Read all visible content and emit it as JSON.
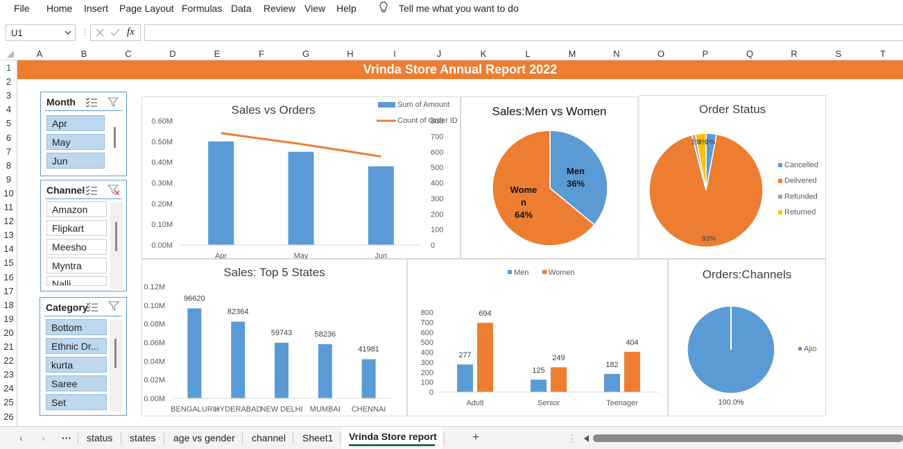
{
  "menu": {
    "items": [
      "File",
      "Home",
      "Insert",
      "Page Layout",
      "Formulas",
      "Data",
      "Review",
      "View",
      "Help"
    ],
    "tell_me": "Tell me what you want to do"
  },
  "formula_bar": {
    "name_box": "U1",
    "fx": "fx",
    "formula": ""
  },
  "columns": [
    "A",
    "B",
    "C",
    "D",
    "E",
    "F",
    "G",
    "H",
    "I",
    "J",
    "K",
    "L",
    "M",
    "N",
    "O",
    "P",
    "Q",
    "R",
    "S",
    "T"
  ],
  "rows": [
    "1",
    "2",
    "3",
    "4",
    "5",
    "6",
    "7",
    "8",
    "9",
    "10",
    "11",
    "12",
    "13",
    "14",
    "15",
    "16",
    "17",
    "18",
    "19",
    "20",
    "21",
    "22",
    "23",
    "24",
    "25",
    "26"
  ],
  "banner": {
    "title": "Vrinda Store Annual Report 2022",
    "color": "#ed7d31"
  },
  "slicers": {
    "month": {
      "title": "Month",
      "items": [
        {
          "label": "Apr",
          "selected": true
        },
        {
          "label": "May",
          "selected": true
        },
        {
          "label": "Jun",
          "selected": true
        }
      ]
    },
    "channel": {
      "title": "Channel",
      "items": [
        {
          "label": "Amazon",
          "selected": false
        },
        {
          "label": "Flipkart",
          "selected": false
        },
        {
          "label": "Meesho",
          "selected": false
        },
        {
          "label": "Myntra",
          "selected": false
        },
        {
          "label": "Nalli",
          "selected": false
        }
      ]
    },
    "category": {
      "title": "Category",
      "items": [
        {
          "label": "Bottom",
          "selected": true
        },
        {
          "label": "Ethnic Dr...",
          "selected": true
        },
        {
          "label": "kurta",
          "selected": true
        },
        {
          "label": "Saree",
          "selected": true
        },
        {
          "label": "Set",
          "selected": true
        }
      ]
    }
  },
  "chart_data": [
    {
      "id": "sales_vs_orders",
      "type": "bar",
      "title": "Sales vs Orders",
      "categories": [
        "Apr",
        "May",
        "Jun"
      ],
      "series": [
        {
          "name": "Sum of Amount",
          "type": "bar",
          "axis": "left",
          "values": [
            0.5,
            0.45,
            0.38
          ],
          "color": "#5b9bd5"
        },
        {
          "name": "Count of Order ID",
          "type": "line",
          "axis": "right",
          "values": [
            720,
            650,
            570
          ],
          "color": "#ed7d31"
        }
      ],
      "ylim_left": [
        0,
        0.6
      ],
      "yticks_left": [
        "0.00M",
        "0.10M",
        "0.20M",
        "0.30M",
        "0.40M",
        "0.50M",
        "0.60M"
      ],
      "ylim_right": [
        0,
        800
      ],
      "yticks_right": [
        "0",
        "100",
        "200",
        "300",
        "400",
        "500",
        "600",
        "700",
        "800"
      ],
      "legend": "top-right"
    },
    {
      "id": "sales_men_women",
      "type": "pie",
      "title": "Sales:Men vs Women",
      "slices": [
        {
          "label": "Men",
          "value": 36,
          "text": "36%",
          "color": "#5b9bd5"
        },
        {
          "label": "Women",
          "value": 64,
          "text": "64%",
          "color": "#ed7d31"
        }
      ]
    },
    {
      "id": "order_status",
      "type": "pie",
      "title": "Order Status",
      "slices": [
        {
          "label": "Cancelled",
          "value": 3,
          "text": "3%",
          "color": "#5b9bd5"
        },
        {
          "label": "Delivered",
          "value": 93,
          "text": "93%",
          "color": "#ed7d31"
        },
        {
          "label": "Refunded",
          "value": 1,
          "text": "1%",
          "color": "#a5a5a5"
        },
        {
          "label": "Returned",
          "value": 3,
          "text": "3%",
          "color": "#ffc000"
        }
      ],
      "legend": "right"
    },
    {
      "id": "top5_states",
      "type": "bar",
      "title": "Sales: Top 5 States",
      "categories": [
        "BENGALURU",
        "HYDERABAD",
        "NEW DELHI",
        "MUMBAI",
        "CHENNAI"
      ],
      "values": [
        96620,
        82364,
        59743,
        58236,
        41981
      ],
      "labels": [
        "96620",
        "82364",
        "59743",
        "58236",
        "41981"
      ],
      "ylim": [
        0,
        0.12
      ],
      "yticks": [
        "0.00M",
        "0.02M",
        "0.04M",
        "0.06M",
        "0.08M",
        "0.10M",
        "0.12M"
      ],
      "color": "#5b9bd5"
    },
    {
      "id": "age_vs_gender",
      "type": "bar",
      "title": "",
      "categories": [
        "Adult",
        "Senior",
        "Teenager"
      ],
      "series": [
        {
          "name": "Men",
          "values": [
            277,
            125,
            182
          ],
          "color": "#5b9bd5"
        },
        {
          "name": "Women",
          "values": [
            694,
            249,
            404
          ],
          "color": "#ed7d31"
        }
      ],
      "ylim": [
        0,
        800
      ],
      "yticks": [
        "0",
        "100",
        "200",
        "300",
        "400",
        "500",
        "600",
        "700",
        "800"
      ],
      "legend": "top"
    },
    {
      "id": "orders_channels",
      "type": "pie",
      "title": "Orders:Channels",
      "slices": [
        {
          "label": "Ajio",
          "value": 100,
          "text": "100.0%",
          "color": "#5b9bd5"
        }
      ],
      "legend": "right"
    }
  ],
  "sheet_tabs": {
    "tabs": [
      "status",
      "states",
      "age vs gender",
      "channel",
      "Sheet1",
      "Vrinda Store report"
    ],
    "active": "Vrinda Store report",
    "nav_prev": "‹",
    "nav_next": "›",
    "more": "···",
    "add": "+"
  }
}
